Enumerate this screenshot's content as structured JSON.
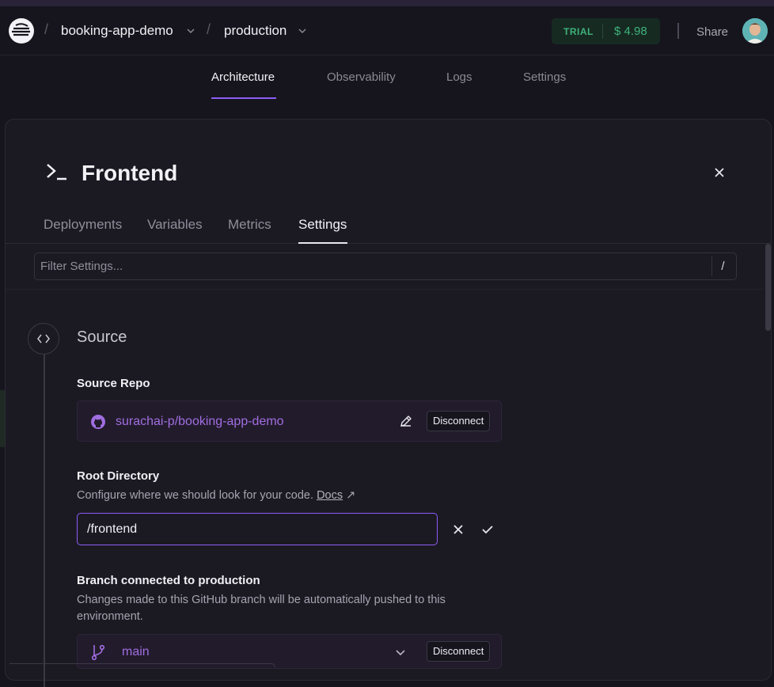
{
  "header": {
    "project": "booking-app-demo",
    "environment": "production",
    "trial_label": "TRIAL",
    "trial_amount": "$ 4.98",
    "share": "Share"
  },
  "nav": {
    "tabs": [
      {
        "label": "Architecture",
        "active": true
      },
      {
        "label": "Observability",
        "active": false
      },
      {
        "label": "Logs",
        "active": false
      },
      {
        "label": "Settings",
        "active": false
      }
    ]
  },
  "panel": {
    "title": "Frontend",
    "tabs": [
      {
        "label": "Deployments",
        "active": false
      },
      {
        "label": "Variables",
        "active": false
      },
      {
        "label": "Metrics",
        "active": false
      },
      {
        "label": "Settings",
        "active": true
      }
    ],
    "filter_placeholder": "Filter Settings...",
    "filter_shortcut": "/",
    "section_title": "Source",
    "source_repo": {
      "label": "Source Repo",
      "repo": "surachai-p/booking-app-demo",
      "disconnect": "Disconnect"
    },
    "root_directory": {
      "label": "Root Directory",
      "description": "Configure where we should look for your code.",
      "docs": "Docs",
      "value": "/frontend"
    },
    "branch": {
      "label": "Branch connected to production",
      "description": "Changes made to this GitHub branch will be automatically pushed to this environment.",
      "value": "main",
      "disconnect": "Disconnect"
    }
  },
  "colors": {
    "accent": "#8b5cf6",
    "repo_text": "#a06ee0",
    "trial_green": "#3fb27a"
  }
}
